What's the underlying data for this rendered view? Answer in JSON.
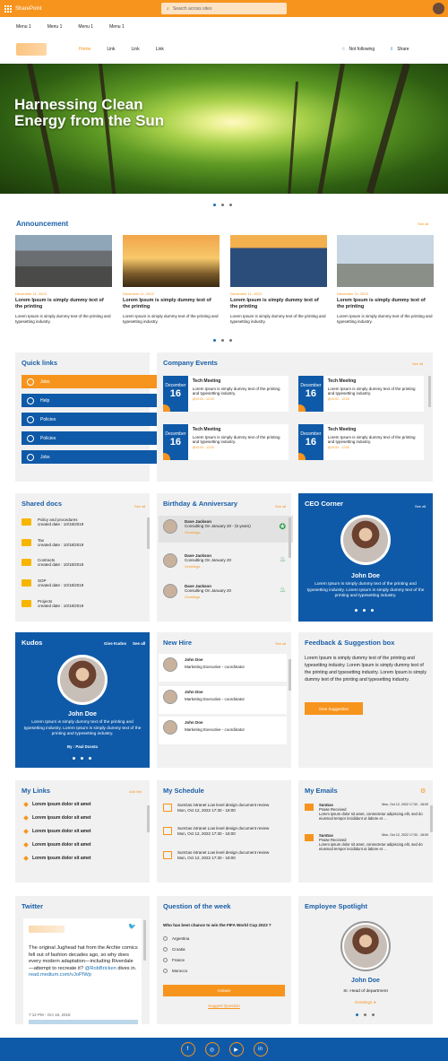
{
  "topbar": {
    "brand": "SharePoint",
    "search_placeholder": "Search across sites"
  },
  "menu": [
    "Menu 1",
    "Menu 1",
    "Menu 1",
    "Menu 1"
  ],
  "site_nav": [
    "Home",
    "Link",
    "Link",
    "Link"
  ],
  "site_actions": {
    "follow": "Not following",
    "share": "Share"
  },
  "hero": {
    "title": "Harnessing Clean Energy from the Sun"
  },
  "announcement": {
    "title": "Announcement",
    "see_all": "See all",
    "items": [
      {
        "date": "December 11, 2023",
        "head": "Lorem Ipsum is simply dummy text of the printing",
        "body": "Lorem Ipsum is simply dummy text of the printing and typesetting industry."
      },
      {
        "date": "December 11, 2023",
        "head": "Lorem Ipsum is simply dummy text of the printing",
        "body": "Lorem Ipsum is simply dummy text of the printing and typesetting industry."
      },
      {
        "date": "December 11, 2023",
        "head": "Lorem Ipsum is simply dummy text of the printing",
        "body": "Lorem Ipsum is simply dummy text of the printing and typesetting industry."
      },
      {
        "date": "December 11, 2023",
        "head": "Lorem Ipsum is simply dummy text of the printing",
        "body": "Lorem Ipsum is simply dummy text of the printing and typesetting industry."
      }
    ]
  },
  "quick_links": {
    "title": "Quick links",
    "items": [
      "Jobs",
      "Help",
      "Policies",
      "Policies",
      "Jobs"
    ]
  },
  "events": {
    "title": "Company Events",
    "see_all": "See all",
    "items": [
      {
        "month": "December",
        "day": "16",
        "title": "Tech Meeting",
        "desc": "Lorem Ipsum is simply dummy text of the printing and typesetting industry.",
        "time": "@10:00 - 12:00"
      },
      {
        "month": "December",
        "day": "16",
        "title": "Tech Meeting",
        "desc": "Lorem Ipsum is simply dummy text of the printing and typesetting industry.",
        "time": "@10:00 - 12:00"
      },
      {
        "month": "December",
        "day": "16",
        "title": "Tech Meeting",
        "desc": "Lorem Ipsum is simply dummy text of the printing and typesetting industry.",
        "time": "@10:00 - 12:00"
      },
      {
        "month": "December",
        "day": "16",
        "title": "Tech Meeting",
        "desc": "Lorem Ipsum is simply dummy text of the printing and typesetting industry.",
        "time": "@10:00 - 12:00"
      }
    ]
  },
  "shared_docs": {
    "title": "Shared docs",
    "see_all": "See all",
    "items": [
      {
        "name": "Policy and procedures",
        "date": "created date : 10/18/2019"
      },
      {
        "name": "Tax",
        "date": "created date : 10/18/2019"
      },
      {
        "name": "Contracts",
        "date": "created date : 10/18/2019"
      },
      {
        "name": "SOP",
        "date": "created date : 10/18/2019"
      },
      {
        "name": "Projects",
        "date": "created date : 10/18/2019"
      }
    ]
  },
  "birthday": {
    "title": "Birthday & Anniversary",
    "see_all": "See all",
    "items": [
      {
        "name": "Dave Jackson",
        "sub": "Consulting On January 20 - (5 years)",
        "greet": "Greetings"
      },
      {
        "name": "Dave Jackson",
        "sub": "Consulting On January 20",
        "greet": "Greetings"
      },
      {
        "name": "Dave Jackson",
        "sub": "Consulting On January 20",
        "greet": "Greetings"
      }
    ]
  },
  "ceo": {
    "title": "CEO Corner",
    "see_all": "See all",
    "name": "John Doe",
    "text": "Lorem Ipsum is simply dummy text of the printing and typesetting industry. Lorem Ipsum is simply dummy text of the printing and typesetting industry."
  },
  "kudos": {
    "title": "Kudos",
    "give": "Give Kudos",
    "see_all": "See all",
    "name": "John Doe",
    "text": "Lorem Ipsum is simply dummy text of the printing and typesetting industry. Lorem Ipsum is simply dummy text of the printing and typesetting industry.",
    "by": "By : Paul Dcosta"
  },
  "new_hire": {
    "title": "New Hire",
    "see_all": "See all",
    "items": [
      {
        "name": "John Doe",
        "role": "Marketing Executive - coordinator"
      },
      {
        "name": "John Doe",
        "role": "Marketing Executive - coordinator"
      },
      {
        "name": "John Doe",
        "role": "Marketing Executive - coordinator"
      }
    ]
  },
  "feedback": {
    "title": "Feedback & Suggestion box",
    "text": "Lorem Ipsum is simply dummy text of the printing and typesetting industry. Lorem Ipsum is simply dummy text of the printing and typesetting industry. Lorem Ipsum is simply dummy text of the printing and typesetting industry.",
    "button": "Give Suggestion"
  },
  "my_links": {
    "title": "My Links",
    "add": "Add link",
    "items": [
      "Lorem ipsum dolor sit amet",
      "Lorem ipsum dolor sit amet",
      "Lorem ipsum dolor sit amet",
      "Lorem ipsum dolor sit amet",
      "Lorem ipsum dolor sit amet",
      "Lorem ipsum dolor sit amet"
    ]
  },
  "schedule": {
    "title": "My Schedule",
    "items": [
      {
        "title": "SunGas intranet Low level design document review",
        "time": "Mon, Oct 12, 2022 17:30 - 18:00"
      },
      {
        "title": "SunGas intranet Low level design document review",
        "time": "Mon, Oct 12, 2022 17:30 - 18:00"
      },
      {
        "title": "SunGas intranet Low level design document review",
        "time": "Mon, Oct 12, 2022 17:30 - 18:00"
      }
    ]
  },
  "emails": {
    "title": "My Emails",
    "items": [
      {
        "from": "SunGas",
        "date": "Mon, Oct 12, 2022 17:30 - 18:00",
        "subject": "Praise Received",
        "preview": "Lorem ipsum dolor sit amet, consectetur adipiscing elit, sed do eiusmod tempor incididunt ut labore et ..."
      },
      {
        "from": "SunGas",
        "date": "Mon, Oct 12, 2022 17:30 - 18:00",
        "subject": "Praise Received",
        "preview": "Lorem ipsum dolor sit amet, consectetur adipiscing elit, sed do eiusmod tempor incididunt ut labore et ..."
      }
    ]
  },
  "twitter": {
    "title": "Twitter",
    "tweet": "The original Jughead hat from the Archie comics fell out of fashion decades ago, so why does every modern adaptation—including Riverdale—attempt to recreate it?",
    "handle": "@RobBricken",
    "handle_suffix": " dives in.",
    "link": "read.medium.com/vJoPIWp",
    "time": "7:12 PM - Oct 18, 2018"
  },
  "question": {
    "title": "Question of the week",
    "q": "Who has best chance to win the FIFA World Cup 2023 ?",
    "options": [
      "Argentina",
      "Croatia",
      "France",
      "Morocco"
    ],
    "answer": "Answer",
    "suggest": "Suggest Question"
  },
  "spotlight": {
    "title": "Employee Spotlight",
    "name": "John Doe",
    "role": "Sr. Head of department",
    "greet": "Greetings"
  },
  "footer": [
    "f",
    "◎",
    "▶",
    "in"
  ],
  "colors": {
    "orange": "#f7941d",
    "blue": "#0f5aa8"
  }
}
